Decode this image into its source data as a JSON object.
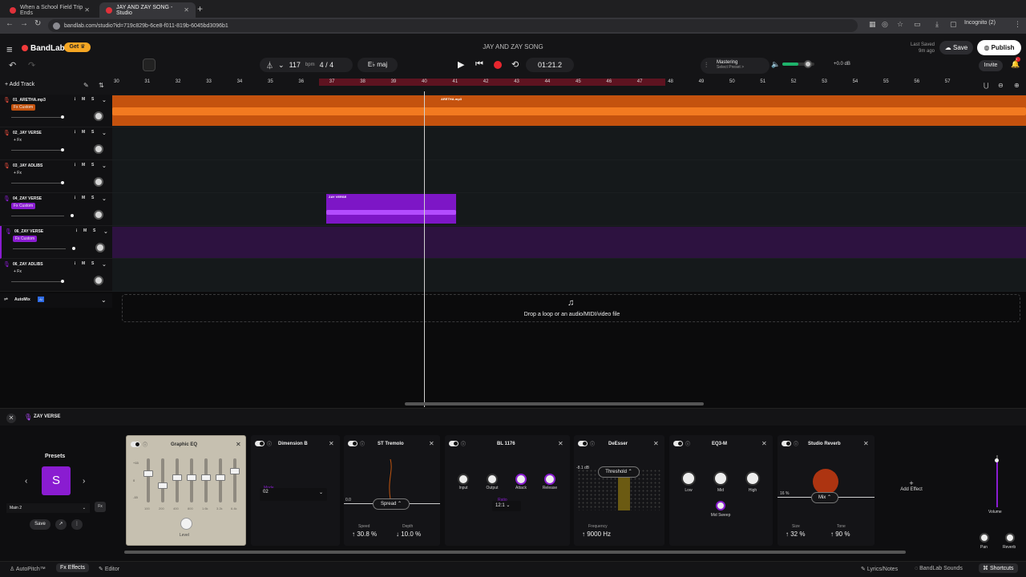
{
  "browser": {
    "tabs": [
      {
        "title": "When a School Field Trip Ends"
      },
      {
        "title": "JAY AND ZAY SONG - Studio"
      }
    ],
    "url": "bandlab.com/studio?id=719c829b-6ce8-f011-819b-6045bd3096b1",
    "incognito": "Incognito (2)"
  },
  "header": {
    "logo": "BandLab",
    "get_label": "Get",
    "song_title": "JAY AND ZAY SONG",
    "last_saved": "Last Saved",
    "last_saved_time": "9m ago",
    "save_label": "Save",
    "publish_label": "Publish",
    "invite_label": "Invite",
    "bell_count": "1"
  },
  "transport": {
    "tempo": "117",
    "bpm_label": "bpm",
    "time_sig": "4 / 4",
    "key": "E♭ maj",
    "time": "01:21.2",
    "mastering_title": "Mastering",
    "mastering_preset": "Select Preset >",
    "master_db": "+0.0 dB"
  },
  "toolbar": {
    "add_track": "Add Track"
  },
  "ruler": {
    "bars": [
      "30",
      "31",
      "32",
      "33",
      "34",
      "35",
      "36",
      "37",
      "38",
      "39",
      "40",
      "41",
      "42",
      "43",
      "44",
      "45",
      "46",
      "47",
      "48",
      "49",
      "50",
      "51",
      "52",
      "53",
      "54",
      "55",
      "56",
      "57"
    ]
  },
  "tracks": [
    {
      "name": "01_ARETHA.mp3",
      "fx": "Fx Custom"
    },
    {
      "name": "02_JAY VERSE",
      "fx": "+ Fx"
    },
    {
      "name": "03_JAY ADLIBS",
      "fx": "+ Fx"
    },
    {
      "name": "04_ZAY VERSE",
      "fx": "Fx Custom"
    },
    {
      "name": "06_ZAY VERSE",
      "fx": "Fx Custom"
    },
    {
      "name": "06_ZAY ADLIBS",
      "fx": "+ Fx"
    }
  ],
  "track_mute": "M",
  "track_solo": "S",
  "clips": {
    "aretha": "ARETHA.mp3",
    "zay": "ZAY VERSE"
  },
  "automix": {
    "label": "AutoMix",
    "badge": "AI"
  },
  "dropzone": "Drop a loop or an audio/MIDI/video file",
  "effects_panel": {
    "track": "ZAY VERSE",
    "presets_title": "Presets",
    "preset_letter": "S",
    "preset_name": "Main 2",
    "fx_button": "Fx",
    "save_label": "Save",
    "cards": {
      "graphic_eq": {
        "title": "Graphic EQ",
        "scale": [
          "+15",
          "0",
          "-15"
        ],
        "bands": [
          "100",
          "200",
          "400",
          "800",
          "1.6k",
          "3.2k",
          "6.4k"
        ],
        "level": "Level"
      },
      "dimension_b": {
        "title": "Dimension B",
        "mode_label": "Mode",
        "mode": "02"
      },
      "st_tremolo": {
        "title": "ST Tremolo",
        "zero": "0.0",
        "spread": "Spread",
        "speed_label": "Speed",
        "speed": "30.8 %",
        "depth_label": "Depth",
        "depth": "10.0 %"
      },
      "bl1176": {
        "title": "BL 1176",
        "input": "Input",
        "output": "Output",
        "attack": "Attack",
        "release": "Release",
        "ratio_label": "Ratio",
        "ratio": "12:1"
      },
      "deesser": {
        "title": "DeEsser",
        "db": "-8.1 dB",
        "threshold": "Threshold",
        "freq_label": "Frequency",
        "freq": "9000 Hz"
      },
      "eq3m": {
        "title": "EQ3-M",
        "low": "Low",
        "mid": "Mid",
        "high": "High",
        "sweep": "Mid Sweep"
      },
      "reverb": {
        "title": "Studio Reverb",
        "pct": "16 %",
        "mix": "Mix",
        "size_label": "Size",
        "size": "32 %",
        "tone_label": "Tone",
        "tone": "90 %"
      }
    },
    "add_effect": "Add Effect",
    "volume": "Volume",
    "pan": "Pan",
    "reverb": "Reverb"
  },
  "bottombar": {
    "autopitch": "AutoPitch™",
    "effects": "Effects",
    "editor": "Editor",
    "lyrics": "Lyrics/Notes",
    "sounds": "BandLab Sounds",
    "shortcuts": "Shortcuts"
  },
  "colors": {
    "accent_purple": "#8a1cd1",
    "clip_orange": "#c4520e",
    "record_red": "#e8262e",
    "brand_red": "#f23b3b"
  }
}
